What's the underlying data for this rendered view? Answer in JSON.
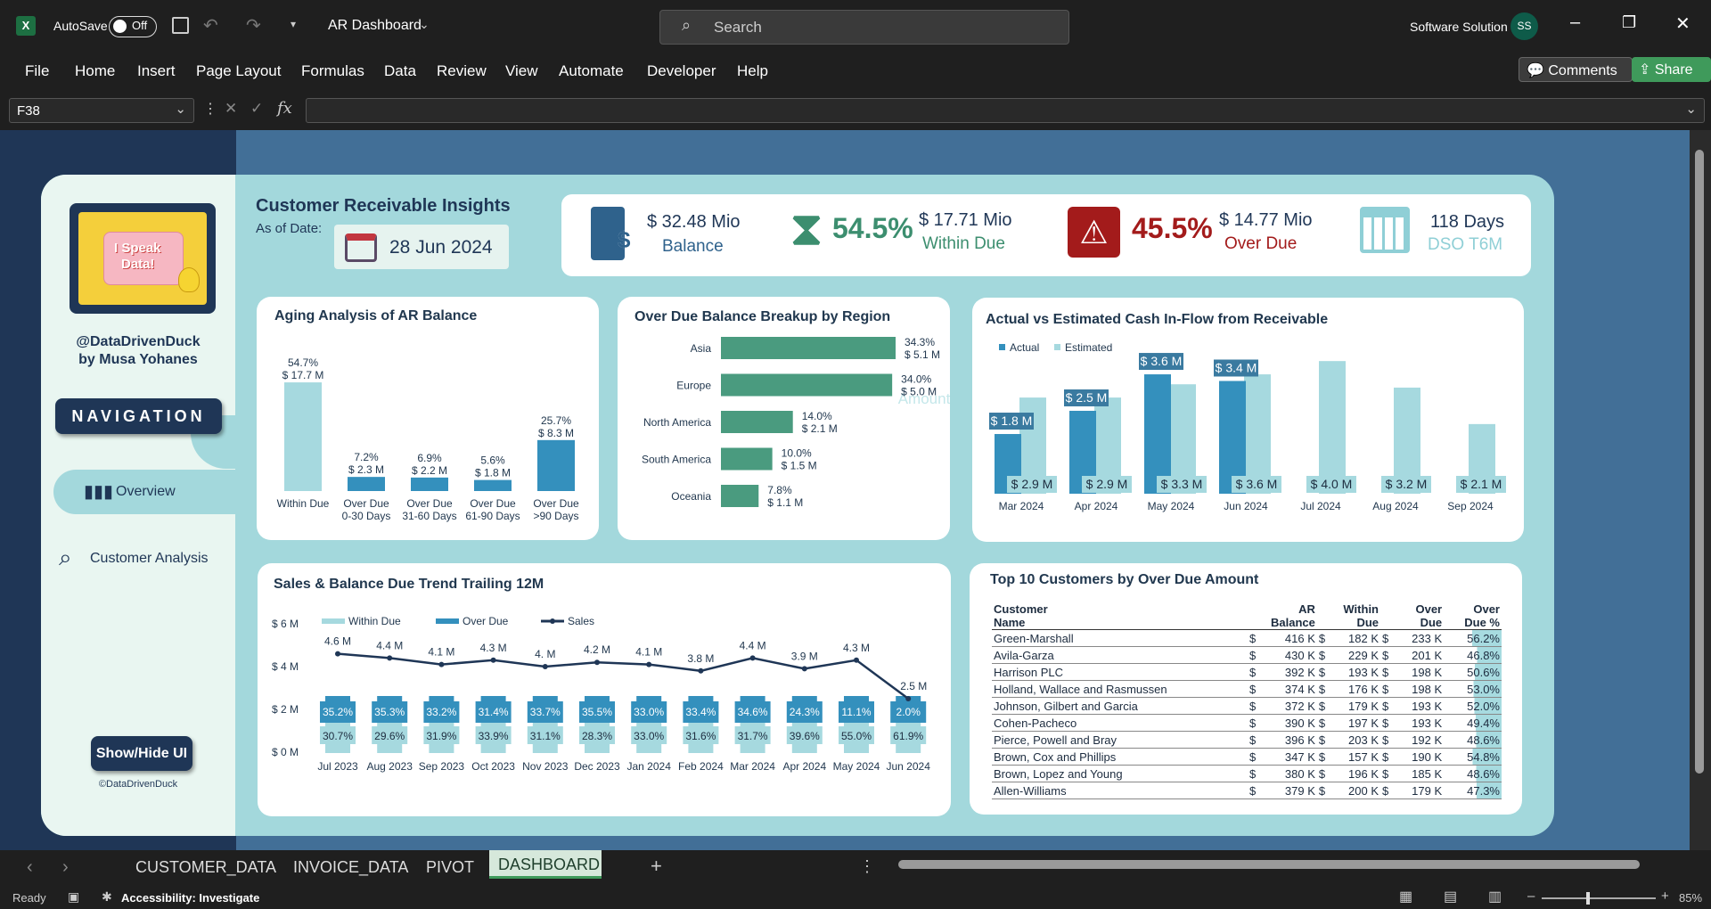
{
  "app": {
    "autosave_label": "AutoSave",
    "autosave_state": "Off",
    "file_name": "AR Dashboard",
    "search_placeholder": "Search",
    "account_name": "Software Solution",
    "account_initials": "SS"
  },
  "menu": [
    "File",
    "Home",
    "Insert",
    "Page Layout",
    "Formulas",
    "Data",
    "Review",
    "View",
    "Automate",
    "Developer",
    "Help"
  ],
  "ribbon_buttons": {
    "comments": "Comments",
    "share": "Share"
  },
  "formula_bar": {
    "name_box": "F38",
    "fx": "fx"
  },
  "sidebar": {
    "logo_line1": "I Speak",
    "logo_line2": "Data!",
    "handle": "@DataDrivenDuck",
    "author": "by Musa Yohanes",
    "nav_title": "NAVIGATION",
    "items": [
      {
        "label": "Overview"
      },
      {
        "label": "Customer Analysis"
      }
    ],
    "toggle_button": "Show/Hide UI",
    "copyright": "©DataDrivenDuck"
  },
  "header": {
    "title": "Customer Receivable Insights",
    "as_of_label": "As of Date:",
    "as_of_date": "28 Jun 2024"
  },
  "kpis": {
    "balance_value": "$ 32.48 Mio",
    "balance_label": "Balance",
    "within_pct": "54.5%",
    "within_value": "$ 17.71 Mio",
    "within_label": "Within Due",
    "over_pct": "45.5%",
    "over_value": "$ 14.77 Mio",
    "over_label": "Over Due",
    "dso_value": "118 Days",
    "dso_label": "DSO T6M"
  },
  "colors": {
    "dark": "#1f3656",
    "teal": "#3490bd",
    "light": "#a6d9df",
    "green": "#4a9b7f",
    "red": "#a31b1b"
  },
  "chart_data": [
    {
      "type": "bar",
      "title": "Aging Analysis of AR Balance",
      "categories": [
        "Within Due",
        "Over Due 0-30 Days",
        "Over Due 31-60 Days",
        "Over Due 61-90 Days",
        "Over Due >90 Days"
      ],
      "cat_lines": [
        [
          "Within Due"
        ],
        [
          "Over Due",
          "0-30 Days"
        ],
        [
          "Over Due",
          "31-60 Days"
        ],
        [
          "Over Due",
          "61-90 Days"
        ],
        [
          "Over Due",
          ">90 Days"
        ]
      ],
      "values": [
        17.7,
        2.3,
        2.2,
        1.8,
        8.3
      ],
      "pct_labels": [
        "54.7%",
        "7.2%",
        "6.9%",
        "5.6%",
        "25.7%"
      ],
      "value_labels": [
        "$ 17.7 M",
        "$ 2.3 M",
        "$ 2.2 M",
        "$ 1.8 M",
        "$ 8.3 M"
      ]
    },
    {
      "type": "bar",
      "title": "Over Due Balance Breakup by Region",
      "categories": [
        "Asia",
        "Europe",
        "North America",
        "South America",
        "Oceania"
      ],
      "values": [
        5.1,
        5.0,
        2.1,
        1.5,
        1.1
      ],
      "pct_labels": [
        "34.3%",
        "34.0%",
        "14.0%",
        "10.0%",
        "7.8%"
      ],
      "value_labels": [
        "$ 5.1 M",
        "$ 5.0 M",
        "$ 2.1 M",
        "$ 1.5 M",
        "$ 1.1 M"
      ],
      "ghost_label": "Amount"
    },
    {
      "type": "bar",
      "title": "Actual vs Estimated Cash In-Flow from Receivable",
      "categories": [
        "Mar 2024",
        "Apr 2024",
        "May 2024",
        "Jun 2024",
        "Jul 2024",
        "Aug 2024",
        "Sep 2024"
      ],
      "series": [
        {
          "name": "Actual",
          "values": [
            1.8,
            2.5,
            3.6,
            3.4,
            null,
            null,
            null
          ],
          "labels": [
            "$ 1.8 M",
            "$ 2.5 M",
            "$ 3.6 M",
            "$ 3.4 M",
            "",
            "",
            ""
          ]
        },
        {
          "name": "Estimated",
          "values": [
            2.9,
            2.9,
            3.3,
            3.6,
            4.0,
            3.2,
            2.1
          ],
          "labels": [
            "$ 2.9 M",
            "$ 2.9 M",
            "$ 3.3 M",
            "$ 3.6 M",
            "$ 4.0 M",
            "$ 3.2 M",
            "$ 2.1 M"
          ]
        }
      ]
    },
    {
      "type": "line",
      "title": "Sales & Balance Due Trend Trailing 12M",
      "categories": [
        "Jul 2023",
        "Aug 2023",
        "Sep 2023",
        "Oct 2023",
        "Nov 2023",
        "Dec 2023",
        "Jan 2024",
        "Feb 2024",
        "Mar 2024",
        "Apr 2024",
        "May 2024",
        "Jun 2024"
      ],
      "yticks": [
        "$ 6 M",
        "$ 4 M",
        "$ 2 M",
        "$ 0 M"
      ],
      "ylim": [
        0,
        6
      ],
      "legend": [
        "Within Due",
        "Over Due",
        "Sales"
      ],
      "sales": [
        4.6,
        4.4,
        4.1,
        4.3,
        4.0,
        4.2,
        4.1,
        3.8,
        4.4,
        3.9,
        4.3,
        2.5
      ],
      "sales_labels": [
        "4.6 M",
        "4.4 M",
        "4.1 M",
        "4.3 M",
        "4. M",
        "4.2 M",
        "4.1 M",
        "3.8 M",
        "4.4 M",
        "3.9 M",
        "4.3 M",
        "2.5 M"
      ],
      "over_due_pct": [
        "35.2%",
        "35.3%",
        "33.2%",
        "31.4%",
        "33.7%",
        "35.5%",
        "33.0%",
        "33.4%",
        "34.6%",
        "24.3%",
        "11.1%",
        "2.0%"
      ],
      "within_due_pct": [
        "30.7%",
        "29.6%",
        "31.9%",
        "33.9%",
        "31.1%",
        "28.3%",
        "33.0%",
        "31.6%",
        "31.7%",
        "39.6%",
        "55.0%",
        "61.9%"
      ]
    }
  ],
  "top10": {
    "title": "Top 10 Customers by Over Due Amount",
    "headers": [
      [
        "Customer",
        "Name"
      ],
      [
        "AR",
        "Balance"
      ],
      [
        "Within",
        "Due"
      ],
      [
        "Over",
        "Due"
      ],
      [
        "Over",
        "Due %"
      ]
    ],
    "rows": [
      [
        "Green-Marshall",
        "416 K",
        "182 K",
        "233 K",
        "56.2%"
      ],
      [
        "Avila-Garza",
        "430 K",
        "229 K",
        "201 K",
        "46.8%"
      ],
      [
        "Harrison PLC",
        "392 K",
        "193 K",
        "198 K",
        "50.6%"
      ],
      [
        "Holland, Wallace and Rasmussen",
        "374 K",
        "176 K",
        "198 K",
        "53.0%"
      ],
      [
        "Johnson, Gilbert and Garcia",
        "372 K",
        "179 K",
        "193 K",
        "52.0%"
      ],
      [
        "Cohen-Pacheco",
        "390 K",
        "197 K",
        "193 K",
        "49.4%"
      ],
      [
        "Pierce, Powell and Bray",
        "396 K",
        "203 K",
        "192 K",
        "48.6%"
      ],
      [
        "Brown, Cox and Phillips",
        "347 K",
        "157 K",
        "190 K",
        "54.8%"
      ],
      [
        "Brown, Lopez and Young",
        "380 K",
        "196 K",
        "185 K",
        "48.6%"
      ],
      [
        "Allen-Williams",
        "379 K",
        "200 K",
        "179 K",
        "47.3%"
      ]
    ],
    "currency": "$",
    "pct_values": [
      56.2,
      46.8,
      50.6,
      53.0,
      52.0,
      49.4,
      48.6,
      54.8,
      48.6,
      47.3
    ]
  },
  "sheet_tabs": [
    "CUSTOMER_DATA",
    "INVOICE_DATA",
    "PIVOT",
    "DASHBOARD"
  ],
  "active_tab": "DASHBOARD",
  "status": {
    "ready": "Ready",
    "accessibility": "Accessibility: Investigate",
    "zoom": "85%"
  }
}
